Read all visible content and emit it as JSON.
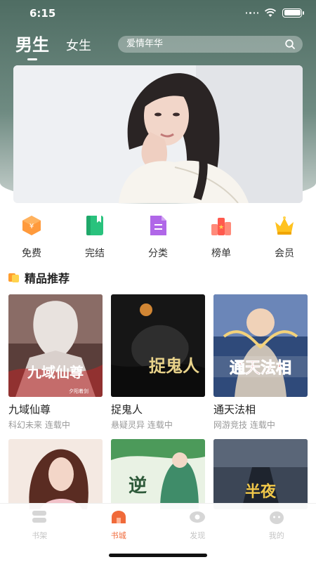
{
  "status": {
    "time": "6:15"
  },
  "header": {
    "tabs": [
      {
        "label": "男生",
        "active": true
      },
      {
        "label": "女生",
        "active": false
      }
    ],
    "search": {
      "placeholder": "爱情年华"
    }
  },
  "categories": [
    {
      "label": "免费",
      "icon": "free-coin-icon"
    },
    {
      "label": "完结",
      "icon": "book-icon"
    },
    {
      "label": "分类",
      "icon": "document-icon"
    },
    {
      "label": "榜单",
      "icon": "ranking-icon"
    },
    {
      "label": "会员",
      "icon": "crown-icon"
    }
  ],
  "section": {
    "title": "精品推荐"
  },
  "books": [
    {
      "title": "九域仙尊",
      "meta": "科幻未来 连载中",
      "cover_text": "九域仙尊",
      "cover_sub": "夕阳着剑"
    },
    {
      "title": "捉鬼人",
      "meta": "悬疑灵异 连载中",
      "cover_text": "捉鬼人"
    },
    {
      "title": "通天法相",
      "meta": "网游竞技 连载中",
      "cover_text": "通天法相"
    },
    {
      "title": "",
      "meta": "",
      "cover_text": ""
    },
    {
      "title": "",
      "meta": "",
      "cover_text": "逆"
    },
    {
      "title": "",
      "meta": "",
      "cover_text": "半夜"
    }
  ],
  "tabbar": [
    {
      "label": "书架",
      "icon": "bookshelf-icon",
      "active": false
    },
    {
      "label": "书城",
      "icon": "bookstore-icon",
      "active": true
    },
    {
      "label": "发现",
      "icon": "discover-icon",
      "active": false
    },
    {
      "label": "我的",
      "icon": "profile-icon",
      "active": false
    }
  ],
  "colors": {
    "accent": "#f06a3a",
    "header": "#4f6d63"
  }
}
